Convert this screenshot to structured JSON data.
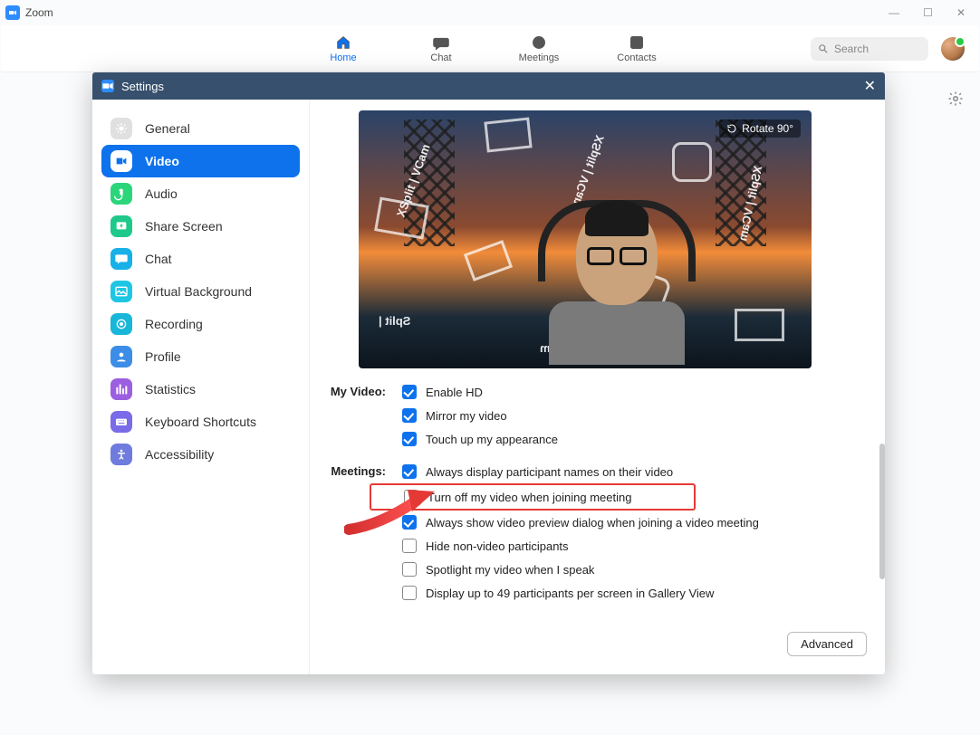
{
  "appTitle": "Zoom",
  "nav": {
    "home": "Home",
    "chat": "Chat",
    "meetings": "Meetings",
    "contacts": "Contacts"
  },
  "search": {
    "placeholder": "Search"
  },
  "settings": {
    "title": "Settings",
    "items": [
      {
        "id": "general",
        "label": "General",
        "iconBg": "#e0e0e0",
        "iconFg": "#fff"
      },
      {
        "id": "video",
        "label": "Video",
        "iconBg": "#0e72ed",
        "iconFg": "#fff",
        "active": true
      },
      {
        "id": "audio",
        "label": "Audio",
        "iconBg": "#2bd67b",
        "iconFg": "#fff"
      },
      {
        "id": "share",
        "label": "Share Screen",
        "iconBg": "#1ec98b",
        "iconFg": "#fff"
      },
      {
        "id": "chat",
        "label": "Chat",
        "iconBg": "#17b1e8",
        "iconFg": "#fff"
      },
      {
        "id": "vbg",
        "label": "Virtual Background",
        "iconBg": "#1fc6e3",
        "iconFg": "#fff"
      },
      {
        "id": "rec",
        "label": "Recording",
        "iconBg": "#18b6d8",
        "iconFg": "#fff"
      },
      {
        "id": "profile",
        "label": "Profile",
        "iconBg": "#3c8de8",
        "iconFg": "#fff"
      },
      {
        "id": "stats",
        "label": "Statistics",
        "iconBg": "#9b5fe0",
        "iconFg": "#fff"
      },
      {
        "id": "kb",
        "label": "Keyboard Shortcuts",
        "iconBg": "#7a6be8",
        "iconFg": "#fff"
      },
      {
        "id": "a11y",
        "label": "Accessibility",
        "iconBg": "#6f7bdd",
        "iconFg": "#fff"
      }
    ]
  },
  "video": {
    "rotateLabel": "Rotate 90°",
    "group1": "My Video:",
    "group2": "Meetings:",
    "opts1": [
      {
        "label": "Enable HD",
        "checked": true
      },
      {
        "label": "Mirror my video",
        "checked": true
      },
      {
        "label": "Touch up my appearance",
        "checked": true
      }
    ],
    "opts2": [
      {
        "label": "Always display participant names on their video",
        "checked": true,
        "highlight": false
      },
      {
        "label": "Turn off my video when joining meeting",
        "checked": false,
        "highlight": true
      },
      {
        "label": "Always show video preview dialog when joining a video meeting",
        "checked": true,
        "highlight": false
      },
      {
        "label": "Hide non-video participants",
        "checked": false,
        "highlight": false
      },
      {
        "label": "Spotlight my video when I speak",
        "checked": false,
        "highlight": false
      },
      {
        "label": "Display up to 49 participants per screen in Gallery View",
        "checked": false,
        "highlight": false
      }
    ],
    "advanced": "Advanced"
  }
}
